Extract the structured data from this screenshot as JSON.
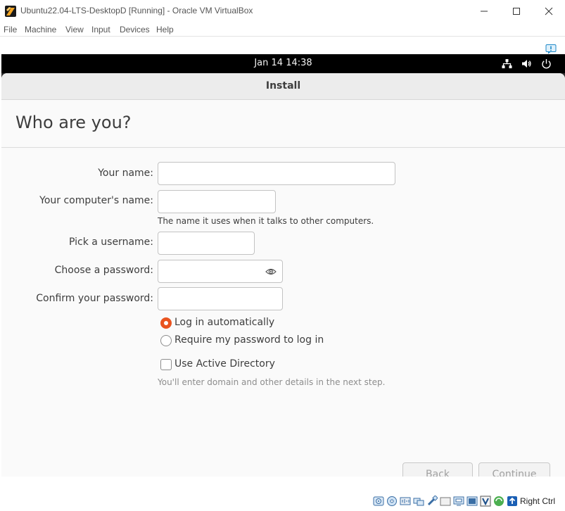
{
  "host_window": {
    "title": "Ubuntu22.04-LTS-DesktopD [Running] - Oracle VM VirtualBox",
    "controls": {
      "minimize": "—",
      "maximize": "☐",
      "close": "✕"
    },
    "menu": [
      "File",
      "Machine",
      "View",
      "Input",
      "Devices",
      "Help"
    ]
  },
  "guest": {
    "topbar": {
      "clock": "Jan 14  14:38",
      "tray_icons": [
        "network-icon",
        "volume-icon",
        "power-icon"
      ]
    },
    "installer": {
      "window_title": "Install",
      "heading": "Who are you?",
      "fields": {
        "name": {
          "label": "Your name:",
          "value": ""
        },
        "computer": {
          "label": "Your computer's name:",
          "value": "",
          "hint": "The name it uses when it talks to other computers."
        },
        "username": {
          "label": "Pick a username:",
          "value": ""
        },
        "password": {
          "label": "Choose a password:",
          "value": ""
        },
        "confirm": {
          "label": "Confirm your password:",
          "value": ""
        }
      },
      "login_options": [
        {
          "label": "Log in automatically",
          "selected": true
        },
        {
          "label": "Require my password to log in",
          "selected": false
        }
      ],
      "active_directory": {
        "label": "Use Active Directory",
        "checked": false,
        "hint": "You'll enter domain and other details in the next step."
      },
      "buttons": {
        "back": "Back",
        "continue": "Continue"
      }
    }
  },
  "statusbar": {
    "host_key": "Right Ctrl"
  },
  "colors": {
    "accent": "#e95420",
    "topbar": "#000000",
    "dialog_bg": "#fafafa"
  }
}
